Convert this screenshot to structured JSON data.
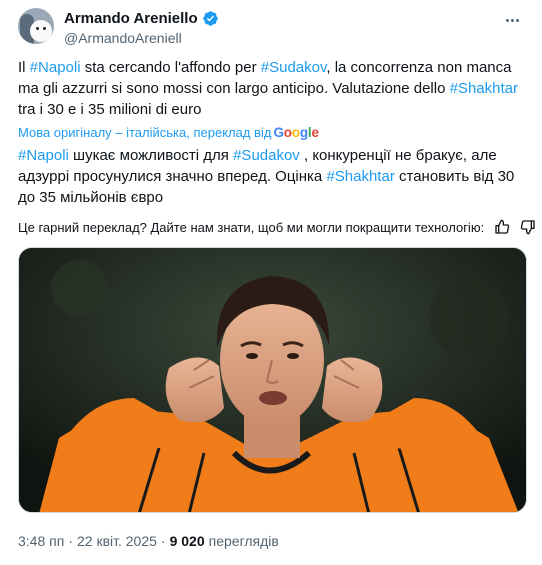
{
  "author": {
    "name": "Armando Areniello",
    "handle": "@ArmandoAreniell",
    "verified": true,
    "avatar": "avatar-dog-and-person"
  },
  "tweet": {
    "original": {
      "p1": "Il ",
      "tag1": "#Napoli",
      "p2": " sta cercando l'affondo per ",
      "tag2": "#Sudakov",
      "p3": ", la concorrenza non manca ma gli azzurri si sono mossi con largo anticipo. Valutazione dello ",
      "tag3": "#Shakhtar",
      "p4": " tra i 30 e i 35 milioni di euro"
    },
    "translated_by_label": "Мова оригіналу – італійська, переклад від",
    "translation_provider": [
      "G",
      "o",
      "o",
      "g",
      "l",
      "e"
    ],
    "translation": {
      "tag1": "#Napoli",
      "p1": " шукає можливості для ",
      "tag2": "#Sudakov",
      "p2": " , конкуренції не бракує, але адзуррі просунулися значно вперед. Оцінка ",
      "tag3": "#Shakhtar",
      "p3": " становить від 30 до 35 мільйонів євро"
    },
    "feedback_prompt": "Це гарний переклад? Дайте нам знати, щоб ми могли покращити технологію:",
    "time": "3:48 пп",
    "separator": "·",
    "date": "22 квіт. 2025",
    "views_count": "9 020",
    "views_label": "переглядів"
  },
  "colors": {
    "link": "#1d9bf0",
    "text": "#0f1419",
    "secondary": "#536471",
    "jersey": "#f07c1a"
  },
  "icons": [
    "more-icon",
    "verified-badge-icon",
    "thumbs-up-icon",
    "thumbs-down-icon"
  ]
}
